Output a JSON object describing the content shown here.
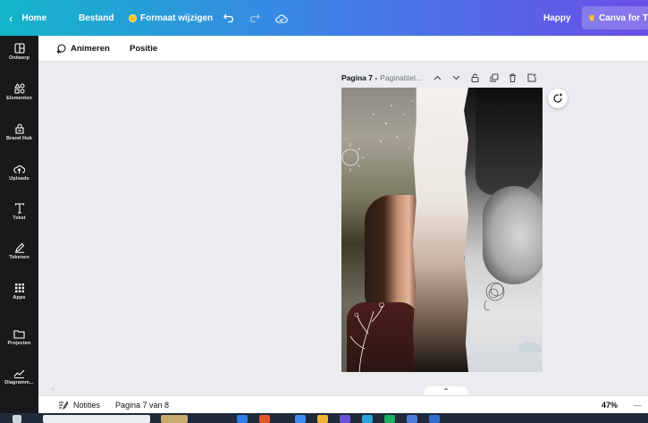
{
  "topbar": {
    "home": "Home",
    "file": "Bestand",
    "resize": "Formaat wijzigen",
    "user": "Happy",
    "canva_for": "Canva for T"
  },
  "sidebar": {
    "items": [
      {
        "label": "Ontwerp",
        "icon": "layout-icon"
      },
      {
        "label": "Elementen",
        "icon": "shapes-icon"
      },
      {
        "label": "Brand Hub",
        "icon": "brand-icon"
      },
      {
        "label": "Uploads",
        "icon": "upload-cloud-icon"
      },
      {
        "label": "Tekst",
        "icon": "text-icon"
      },
      {
        "label": "Tekenen",
        "icon": "draw-icon"
      },
      {
        "label": "Apps",
        "icon": "apps-grid-icon"
      },
      {
        "label": "Projecten",
        "icon": "folder-icon"
      },
      {
        "label": "Diagramm...",
        "icon": "chart-icon"
      }
    ]
  },
  "subbar": {
    "animate": "Animeren",
    "position": "Positie"
  },
  "page_header": {
    "page_number": "Pagina 7 -",
    "page_title": "Paginatitel..."
  },
  "bottombar": {
    "notes": "Notities",
    "page_indicator": "Pagina 7 van 8",
    "zoom": "47%",
    "dash": "—"
  },
  "colors": {
    "brand_gradient_start": "#13b5c9",
    "brand_gradient_end": "#6a4ee8",
    "sidebar_bg": "#18191b",
    "workspace_bg": "#ebecf0"
  }
}
